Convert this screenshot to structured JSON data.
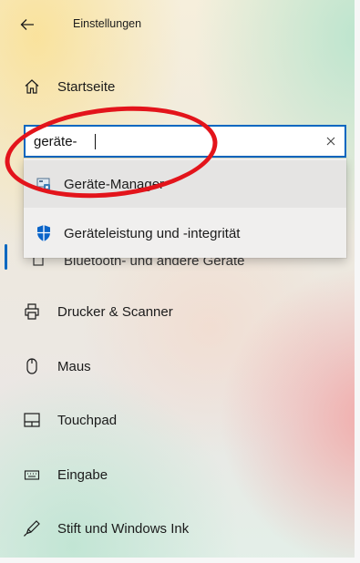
{
  "window": {
    "title": "Einstellungen"
  },
  "nav": {
    "home_label": "Startseite",
    "items": [
      {
        "label": "Bluetooth- und andere Geräte",
        "icon": "bluetooth-devices-icon"
      },
      {
        "label": "Drucker & Scanner",
        "icon": "printer-icon"
      },
      {
        "label": "Maus",
        "icon": "mouse-icon"
      },
      {
        "label": "Touchpad",
        "icon": "touchpad-icon"
      },
      {
        "label": "Eingabe",
        "icon": "keyboard-icon"
      },
      {
        "label": "Stift und Windows Ink",
        "icon": "pen-icon"
      }
    ]
  },
  "search": {
    "value": "geräte-",
    "suggestions": [
      {
        "label": "Geräte-Manager",
        "icon": "device-manager-icon"
      },
      {
        "label": "Geräteleistung und -integrität",
        "icon": "shield-icon"
      }
    ]
  },
  "colors": {
    "accent": "#0067c0",
    "highlight_oval": "#e3141b"
  }
}
